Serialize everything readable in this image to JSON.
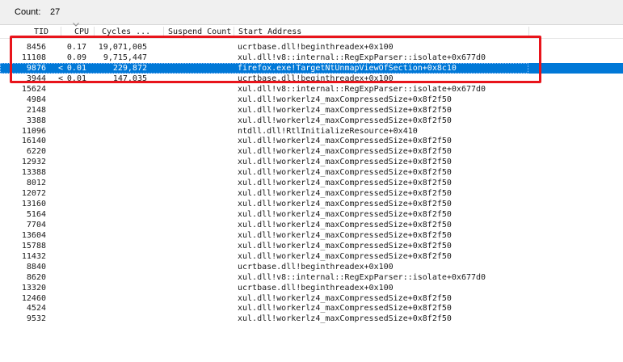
{
  "count_bar": {
    "label": "Count:",
    "value": "27"
  },
  "columns": [
    {
      "name": "tid",
      "label": "TID"
    },
    {
      "name": "cpu",
      "label": "CPU"
    },
    {
      "name": "cycles",
      "label": "Cycles ..."
    },
    {
      "name": "suspend",
      "label": "Suspend Count"
    },
    {
      "name": "start",
      "label": "Start Address"
    }
  ],
  "sort_icon": "chevron-down-icon",
  "selection_color": "#0078d7",
  "highlight_color": "#e8141b",
  "rows": [
    {
      "tid": "8456",
      "lt": "",
      "cpu": "0.17",
      "cycles": "19,071,005",
      "suspend": "",
      "start": "ucrtbase.dll!beginthreadex+0x100"
    },
    {
      "tid": "11108",
      "lt": "",
      "cpu": "0.09",
      "cycles": "9,715,447",
      "suspend": "",
      "start": "xul.dll!v8::internal::RegExpParser::isolate+0x677d0"
    },
    {
      "tid": "9876",
      "lt": "<",
      "cpu": "0.01",
      "cycles": "229,872",
      "suspend": "",
      "start": "firefox.exe!TargetNtUnmapViewOfSection+0x8c10",
      "selected": true
    },
    {
      "tid": "3944",
      "lt": "<",
      "cpu": "0.01",
      "cycles": "147,035",
      "suspend": "",
      "start": "ucrtbase.dll!beginthreadex+0x100"
    },
    {
      "tid": "15624",
      "lt": "",
      "cpu": "",
      "cycles": "",
      "suspend": "",
      "start": "xul.dll!v8::internal::RegExpParser::isolate+0x677d0"
    },
    {
      "tid": "4984",
      "lt": "",
      "cpu": "",
      "cycles": "",
      "suspend": "",
      "start": "xul.dll!workerlz4_maxCompressedSize+0x8f2f50"
    },
    {
      "tid": "2148",
      "lt": "",
      "cpu": "",
      "cycles": "",
      "suspend": "",
      "start": "xul.dll!workerlz4_maxCompressedSize+0x8f2f50"
    },
    {
      "tid": "3388",
      "lt": "",
      "cpu": "",
      "cycles": "",
      "suspend": "",
      "start": "xul.dll!workerlz4_maxCompressedSize+0x8f2f50"
    },
    {
      "tid": "11096",
      "lt": "",
      "cpu": "",
      "cycles": "",
      "suspend": "",
      "start": "ntdll.dll!RtlInitializeResource+0x410"
    },
    {
      "tid": "16140",
      "lt": "",
      "cpu": "",
      "cycles": "",
      "suspend": "",
      "start": "xul.dll!workerlz4_maxCompressedSize+0x8f2f50"
    },
    {
      "tid": "6220",
      "lt": "",
      "cpu": "",
      "cycles": "",
      "suspend": "",
      "start": "xul.dll!workerlz4_maxCompressedSize+0x8f2f50"
    },
    {
      "tid": "12932",
      "lt": "",
      "cpu": "",
      "cycles": "",
      "suspend": "",
      "start": "xul.dll!workerlz4_maxCompressedSize+0x8f2f50"
    },
    {
      "tid": "13388",
      "lt": "",
      "cpu": "",
      "cycles": "",
      "suspend": "",
      "start": "xul.dll!workerlz4_maxCompressedSize+0x8f2f50"
    },
    {
      "tid": "8012",
      "lt": "",
      "cpu": "",
      "cycles": "",
      "suspend": "",
      "start": "xul.dll!workerlz4_maxCompressedSize+0x8f2f50"
    },
    {
      "tid": "12072",
      "lt": "",
      "cpu": "",
      "cycles": "",
      "suspend": "",
      "start": "xul.dll!workerlz4_maxCompressedSize+0x8f2f50"
    },
    {
      "tid": "13160",
      "lt": "",
      "cpu": "",
      "cycles": "",
      "suspend": "",
      "start": "xul.dll!workerlz4_maxCompressedSize+0x8f2f50"
    },
    {
      "tid": "5164",
      "lt": "",
      "cpu": "",
      "cycles": "",
      "suspend": "",
      "start": "xul.dll!workerlz4_maxCompressedSize+0x8f2f50"
    },
    {
      "tid": "7704",
      "lt": "",
      "cpu": "",
      "cycles": "",
      "suspend": "",
      "start": "xul.dll!workerlz4_maxCompressedSize+0x8f2f50"
    },
    {
      "tid": "13604",
      "lt": "",
      "cpu": "",
      "cycles": "",
      "suspend": "",
      "start": "xul.dll!workerlz4_maxCompressedSize+0x8f2f50"
    },
    {
      "tid": "15788",
      "lt": "",
      "cpu": "",
      "cycles": "",
      "suspend": "",
      "start": "xul.dll!workerlz4_maxCompressedSize+0x8f2f50"
    },
    {
      "tid": "11432",
      "lt": "",
      "cpu": "",
      "cycles": "",
      "suspend": "",
      "start": "xul.dll!workerlz4_maxCompressedSize+0x8f2f50"
    },
    {
      "tid": "8840",
      "lt": "",
      "cpu": "",
      "cycles": "",
      "suspend": "",
      "start": "ucrtbase.dll!beginthreadex+0x100"
    },
    {
      "tid": "8620",
      "lt": "",
      "cpu": "",
      "cycles": "",
      "suspend": "",
      "start": "xul.dll!v8::internal::RegExpParser::isolate+0x677d0"
    },
    {
      "tid": "13320",
      "lt": "",
      "cpu": "",
      "cycles": "",
      "suspend": "",
      "start": "ucrtbase.dll!beginthreadex+0x100"
    },
    {
      "tid": "12460",
      "lt": "",
      "cpu": "",
      "cycles": "",
      "suspend": "",
      "start": "xul.dll!workerlz4_maxCompressedSize+0x8f2f50"
    },
    {
      "tid": "4524",
      "lt": "",
      "cpu": "",
      "cycles": "",
      "suspend": "",
      "start": "xul.dll!workerlz4_maxCompressedSize+0x8f2f50"
    },
    {
      "tid": "9532",
      "lt": "",
      "cpu": "",
      "cycles": "",
      "suspend": "",
      "start": "xul.dll!workerlz4_maxCompressedSize+0x8f2f50"
    }
  ]
}
